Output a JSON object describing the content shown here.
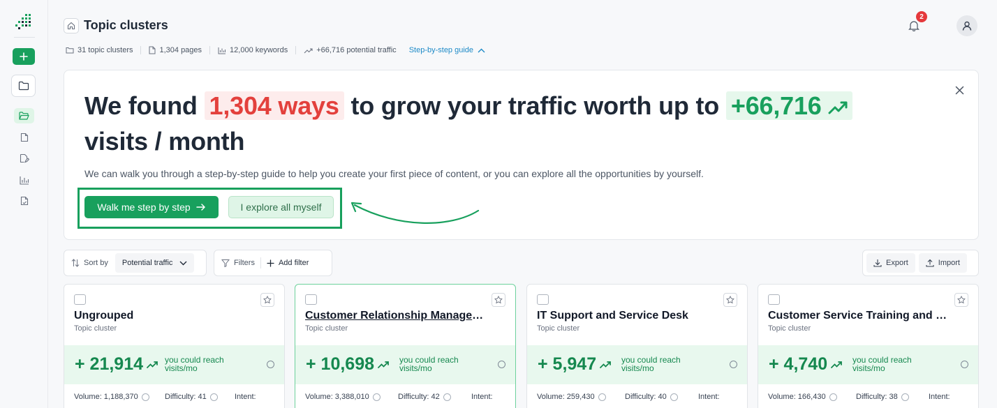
{
  "header": {
    "title": "Topic clusters",
    "notification_count": "2",
    "stats": [
      {
        "icon": "folder-icon",
        "text": "31 topic clusters"
      },
      {
        "icon": "page-icon",
        "text": "1,304 pages"
      },
      {
        "icon": "bar-chart-icon",
        "text": "12,000 keywords"
      },
      {
        "icon": "trend-up-icon",
        "text": "+66,716 potential traffic"
      }
    ],
    "guide_link": "Step-by-step guide"
  },
  "banner": {
    "headline_part1": "We found",
    "headline_ways": "1,304 ways",
    "headline_part2": "to grow your traffic worth up to",
    "headline_visits": "+66,716",
    "headline_part3": "visits / month",
    "description": "We can walk you through a step-by-step guide to help you create your first piece of content, or you can explore all the opportunities by yourself.",
    "walk_button": "Walk me step by step",
    "explore_button": "I explore all myself"
  },
  "toolbar": {
    "sort_label": "Sort by",
    "sort_value": "Potential traffic",
    "filters_label": "Filters",
    "add_filter": "Add filter",
    "export_label": "Export",
    "import_label": "Import"
  },
  "cards": [
    {
      "title": "Ungrouped",
      "subtitle": "Topic cluster",
      "traffic": "+ 21,914",
      "traffic_desc": "you could reach visits/mo",
      "volume": "Volume: 1,188,370",
      "difficulty": "Difficulty: 41",
      "intent": "Intent:"
    },
    {
      "title": "Customer Relationship Management Software",
      "subtitle": "Topic cluster",
      "traffic": "+ 10,698",
      "traffic_desc": "you could reach visits/mo",
      "volume": "Volume: 3,388,010",
      "difficulty": "Difficulty: 42",
      "intent": "Intent:"
    },
    {
      "title": "IT Support and Service Desk",
      "subtitle": "Topic cluster",
      "traffic": "+ 5,947",
      "traffic_desc": "you could reach visits/mo",
      "volume": "Volume: 259,430",
      "difficulty": "Difficulty: 40",
      "intent": "Intent:"
    },
    {
      "title": "Customer Service Training and Support",
      "subtitle": "Topic cluster",
      "traffic": "+ 4,740",
      "traffic_desc": "you could reach visits/mo",
      "volume": "Volume: 166,430",
      "difficulty": "Difficulty: 38",
      "intent": "Intent:"
    }
  ],
  "colors": {
    "brand_green": "#18a05d",
    "highlight_red": "#e3403c",
    "link_blue": "#1d8ac7"
  }
}
